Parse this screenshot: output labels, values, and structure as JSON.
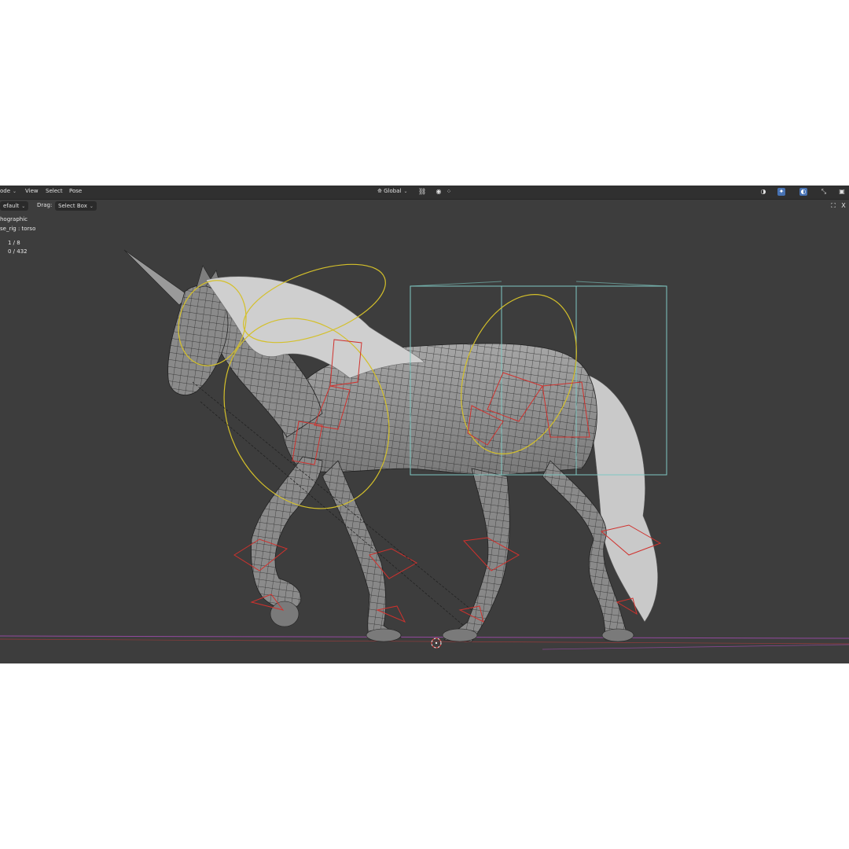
{
  "header": {
    "mode_label": "ode",
    "menu": [
      "View",
      "Select",
      "Pose"
    ],
    "orientation": "Global"
  },
  "toolbar": {
    "preset": "efault",
    "drag_label": "Drag:",
    "drag_value": "Select Box"
  },
  "viewport_info": {
    "view_name": "hographic",
    "object_name": "se_rig : torso",
    "stat_1": "1 / 8",
    "stat_2": "0 / 432"
  },
  "colors": {
    "viewport_bg": "#3d3d3d",
    "header_bg": "#303030",
    "bone_red": "#d0312d",
    "control_yellow": "#d4c02a",
    "control_cyan": "#7fc8c2",
    "floor_magenta": "#b84fc8",
    "active_icon": "#4772b3"
  },
  "icons": [
    "transform-pivot-icon",
    "snap-icon",
    "proportional-icon",
    "visibility-icon",
    "gizmo-icon",
    "overlay-icon",
    "shading-icon",
    "xray-icon",
    "tool-settings-icon",
    "close-icon"
  ]
}
